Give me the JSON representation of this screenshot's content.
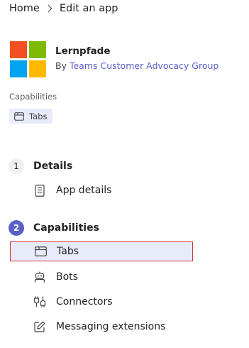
{
  "breadcrumb": {
    "home": "Home",
    "current": "Edit an app"
  },
  "app": {
    "name": "Lernpfade",
    "by_prefix": "By",
    "publisher": "Teams Customer Advocacy Group",
    "logo_colors": [
      "#f25022",
      "#7fba00",
      "#00a4ef",
      "#ffb900"
    ]
  },
  "capabilities_summary": {
    "label": "Capabilities",
    "chips": [
      {
        "label": "Tabs",
        "icon": "tab-icon"
      }
    ]
  },
  "steps": [
    {
      "number": "1",
      "title": "Details",
      "status": "inactive",
      "items": [
        {
          "label": "App details",
          "icon": "document-icon"
        }
      ]
    },
    {
      "number": "2",
      "title": "Capabilities",
      "status": "active",
      "items": [
        {
          "label": "Tabs",
          "icon": "tab-icon",
          "selected": true
        },
        {
          "label": "Bots",
          "icon": "bot-icon"
        },
        {
          "label": "Connectors",
          "icon": "plug-icon"
        },
        {
          "label": "Messaging extensions",
          "icon": "edit-icon"
        }
      ]
    }
  ],
  "colors": {
    "accent": "#5b5fc7",
    "selection_fill": "#e8ebfa",
    "highlight_border": "#d13438"
  }
}
